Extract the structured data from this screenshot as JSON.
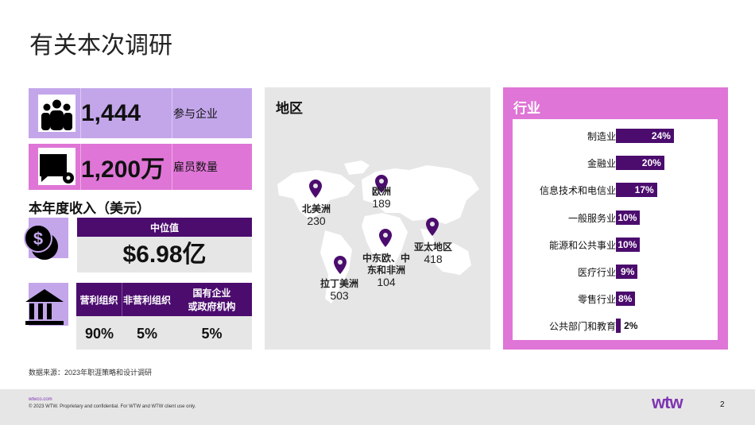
{
  "title": "有关本次调研",
  "stats": [
    {
      "value": "1,444",
      "label": "参与企业",
      "icon": "people-icon"
    },
    {
      "value": "1,200万",
      "label": "雇员数量",
      "icon": "chat-gear-icon"
    }
  ],
  "revenue": {
    "heading": "本年度收入（美元）",
    "median_label": "中位值",
    "median_value": "$6.98亿"
  },
  "org_types": {
    "headers": [
      "营利组织",
      "非营利组织",
      "国有企业\n或政府机构"
    ],
    "values": [
      "90%",
      "5%",
      "5%"
    ]
  },
  "region": {
    "title": "地区",
    "items": [
      {
        "name": "北美洲",
        "count": "230"
      },
      {
        "name": "欧洲",
        "count": "189"
      },
      {
        "name": "亚太地区",
        "count": "418"
      },
      {
        "name": "中东欧、中东和非洲",
        "count": "104"
      },
      {
        "name": "拉丁美洲",
        "count": "503"
      }
    ]
  },
  "industry": {
    "title": "行业",
    "items": [
      {
        "label": "制造业",
        "value": 24,
        "text": "24%"
      },
      {
        "label": "金融业",
        "value": 20,
        "text": "20%"
      },
      {
        "label": "信息技术和电信业",
        "value": 17,
        "text": "17%"
      },
      {
        "label": "一般服务业",
        "value": 10,
        "text": "10%"
      },
      {
        "label": "能源和公共事业",
        "value": 10,
        "text": "10%"
      },
      {
        "label": "医疗行业",
        "value": 9,
        "text": "9%"
      },
      {
        "label": "零售行业",
        "value": 8,
        "text": "8%"
      },
      {
        "label": "公共部门和教育",
        "value": 2,
        "text": "2%"
      }
    ]
  },
  "source": "数据来源：2023年职涯策略和设计调研",
  "footer": {
    "site": "wtwco.com",
    "copyright": "© 2023 WTW. Proprietary and confidential. For WTW and WTW client use only.",
    "logo": "wtw",
    "page": "2"
  },
  "colors": {
    "purple": "#4b0c6e",
    "lavender": "#c3a6ea",
    "pink": "#df75d6",
    "gray": "#e6e6e6"
  }
}
